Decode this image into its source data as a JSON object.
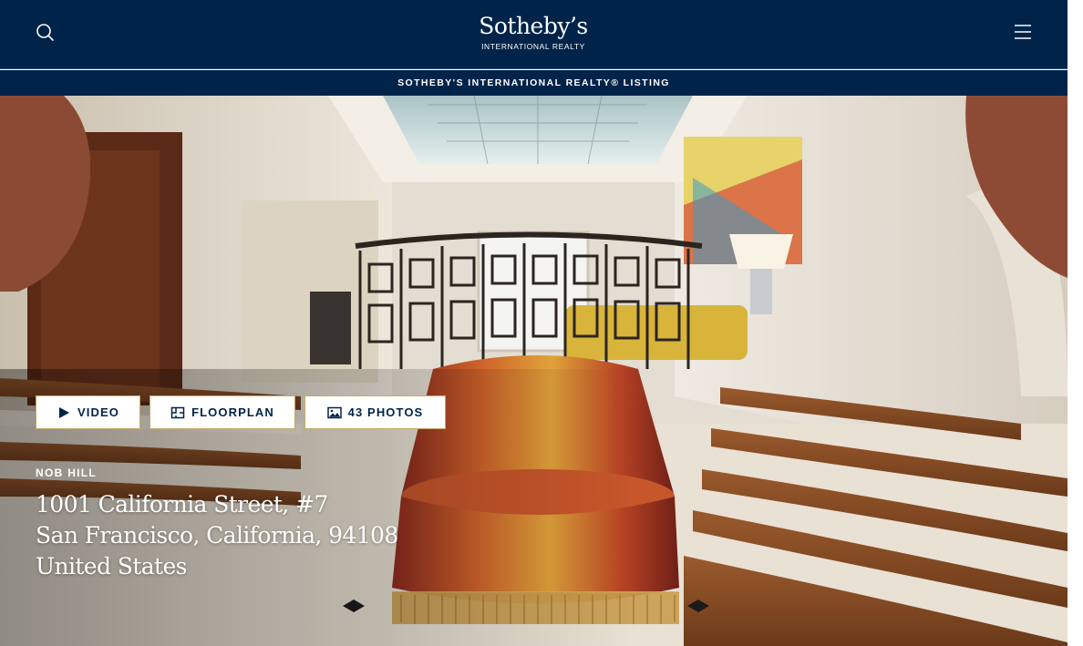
{
  "header": {
    "logo_main": "Sotheby’s",
    "logo_sub": "INTERNATIONAL REALTY",
    "search_icon": "search-icon",
    "menu_icon": "hamburger-menu-icon"
  },
  "listing_bar": {
    "text": "SOTHEBY'S INTERNATIONAL REALTY® LISTING"
  },
  "hero": {
    "buttons": [
      {
        "icon": "play-icon",
        "label": "VIDEO"
      },
      {
        "icon": "floorplan-icon",
        "label": "FLOORPLAN"
      },
      {
        "icon": "photo-icon",
        "label": "43 PHOTOS"
      }
    ],
    "neighborhood": "NOB HILL",
    "address_line1": "1001 California Street, #7",
    "address_line2": "San Francisco, California, 94108",
    "address_line3": "United States"
  },
  "colors": {
    "navy": "#002349",
    "gold_border": "#c8a865",
    "white": "#ffffff"
  }
}
